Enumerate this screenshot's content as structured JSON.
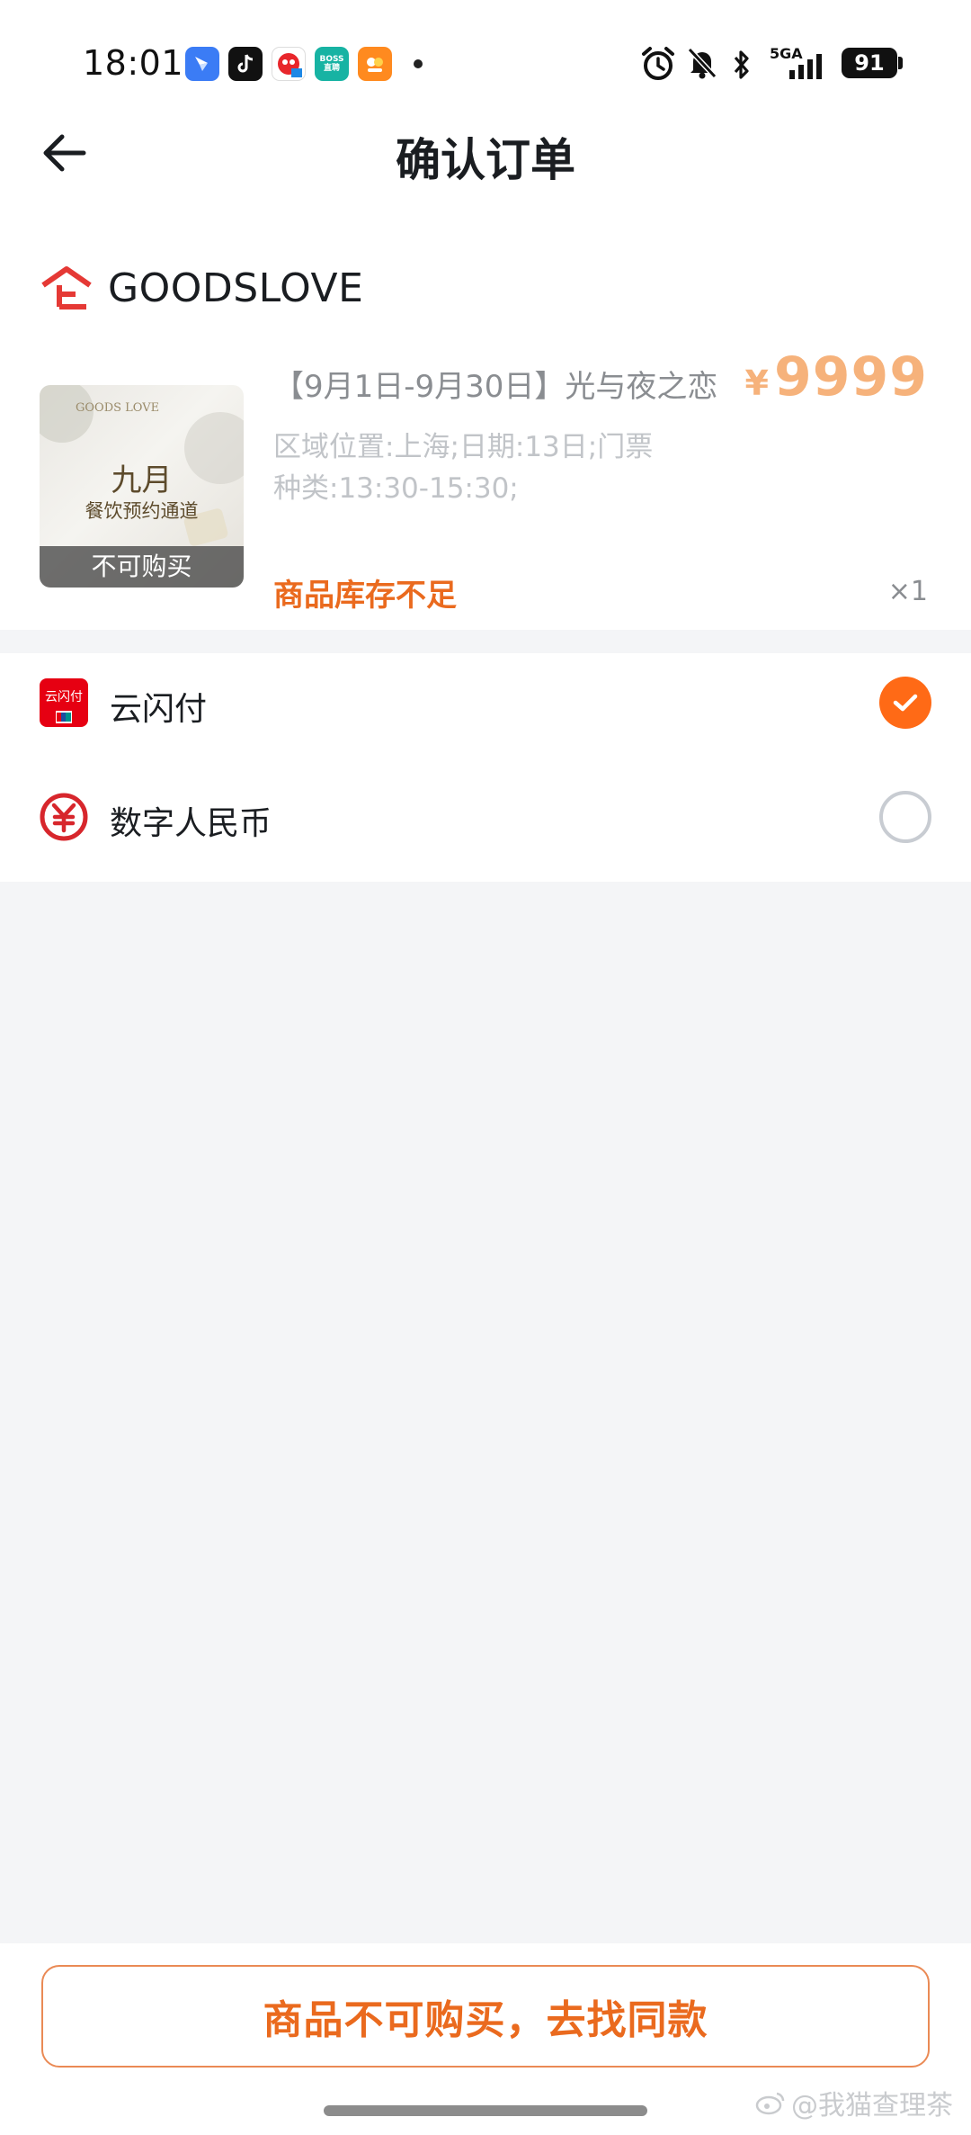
{
  "status_bar": {
    "time": "18:01",
    "network": "5GA",
    "battery": "91",
    "app_icons": [
      "feishu-icon",
      "douyin-icon",
      "app-mascot-icon",
      "boss-zhipin-icon",
      "app-orange-icon"
    ],
    "boss_icon_text": "BOSS\n直聘"
  },
  "header": {
    "title": "确认订单"
  },
  "store": {
    "name": "GOODSLOVE",
    "logo_color": "#e53935"
  },
  "product": {
    "title": "【9月1日-9月30日】光与夜之恋",
    "spec": "区域位置:上海;日期:13日;门票种类:13:30-15:30;",
    "price_symbol": "¥",
    "price": "9999",
    "stock_warning": "商品库存不足",
    "quantity": "×1",
    "thumb_overlay": "不可购买",
    "thumb_month": "九月",
    "thumb_subtitle": "餐饮预约通道",
    "thumb_brand": "GOODS LOVE"
  },
  "payment": {
    "options": [
      {
        "label": "云闪付",
        "logo_text": "云闪付",
        "selected": true
      },
      {
        "label": "数字人民币",
        "selected": false
      }
    ]
  },
  "action": {
    "label": "商品不可购买，去找同款"
  },
  "watermark": {
    "text": "@我猫查理茶"
  },
  "colors": {
    "accent": "#ff6a16",
    "price": "#f6b27b",
    "warning": "#ea6a1e",
    "background": "#f4f5f7"
  }
}
